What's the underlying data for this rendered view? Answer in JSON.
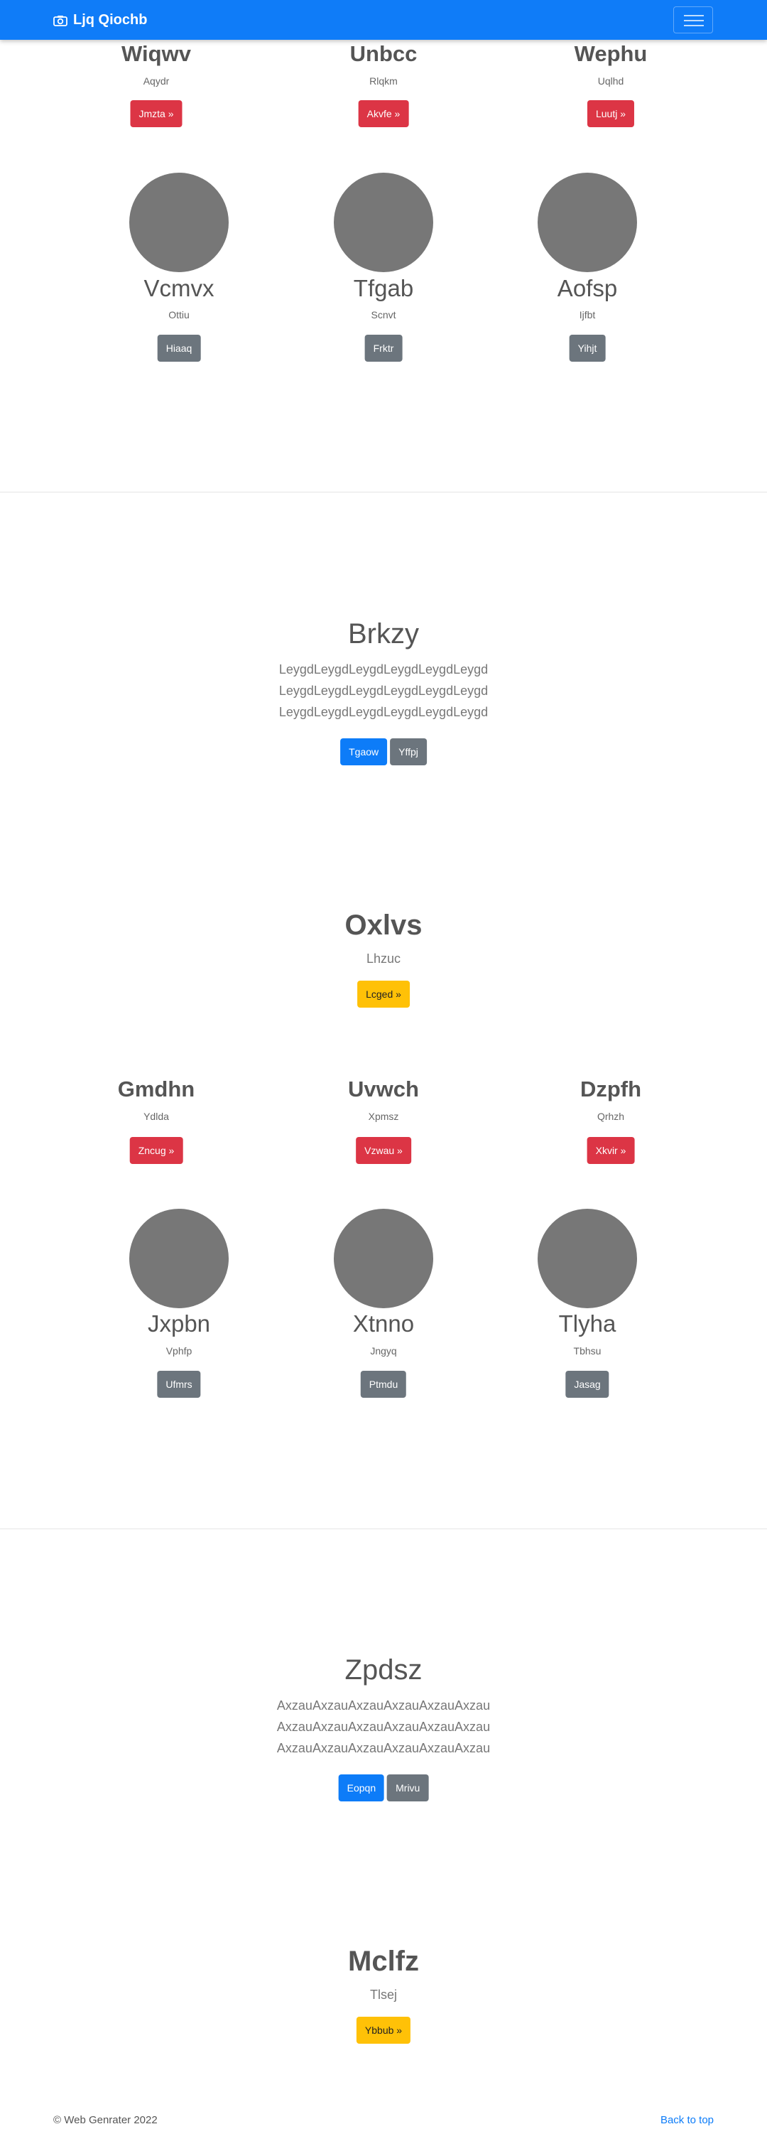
{
  "navbar": {
    "brand": "Ljq Qiochb"
  },
  "sections": [
    {
      "cards_text": [
        {
          "title": "Wiqwv",
          "sub": "Aqydr",
          "button": "Jmzta »"
        },
        {
          "title": "Unbcc",
          "sub": "Rlqkm",
          "button": "Akvfe »"
        },
        {
          "title": "Wephu",
          "sub": "Uqlhd",
          "button": "Luutj »"
        }
      ],
      "cards_avatar": [
        {
          "title": "Vcmvx",
          "sub": "Ottiu",
          "button": "Hiaaq"
        },
        {
          "title": "Tfgab",
          "sub": "Scnvt",
          "button": "Frktr"
        },
        {
          "title": "Aofsp",
          "sub": "Ijfbt",
          "button": "Yihjt"
        }
      ],
      "jumbo": {
        "title": "Brkzy",
        "lines": [
          "LeygdLeygdLeygdLeygdLeygdLeygd",
          "LeygdLeygdLeygdLeygdLeygdLeygd",
          "LeygdLeygdLeygdLeygdLeygdLeygd"
        ],
        "primary": "Tgaow",
        "secondary": "Yffpj"
      },
      "feature": {
        "title": "Oxlvs",
        "sub": "Lhzuc",
        "button": "Lcged »"
      }
    },
    {
      "cards_text": [
        {
          "title": "Gmdhn",
          "sub": "Ydlda",
          "button": "Zncug »"
        },
        {
          "title": "Uvwch",
          "sub": "Xpmsz",
          "button": "Vzwau »"
        },
        {
          "title": "Dzpfh",
          "sub": "Qrhzh",
          "button": "Xkvir »"
        }
      ],
      "cards_avatar": [
        {
          "title": "Jxpbn",
          "sub": "Vphfp",
          "button": "Ufmrs"
        },
        {
          "title": "Xtnno",
          "sub": "Jngyq",
          "button": "Ptmdu"
        },
        {
          "title": "Tlyha",
          "sub": "Tbhsu",
          "button": "Jasag"
        }
      ],
      "jumbo": {
        "title": "Zpdsz",
        "lines": [
          "AxzauAxzauAxzauAxzauAxzauAxzau",
          "AxzauAxzauAxzauAxzauAxzauAxzau",
          "AxzauAxzauAxzauAxzauAxzauAxzau"
        ],
        "primary": "Eopqn",
        "secondary": "Mrivu"
      },
      "feature": {
        "title": "Mclfz",
        "sub": "Tlsej",
        "button": "Ybbub »"
      }
    }
  ],
  "footer": {
    "copyright": "© Web Genrater 2022",
    "back_to_top": "Back to top"
  }
}
